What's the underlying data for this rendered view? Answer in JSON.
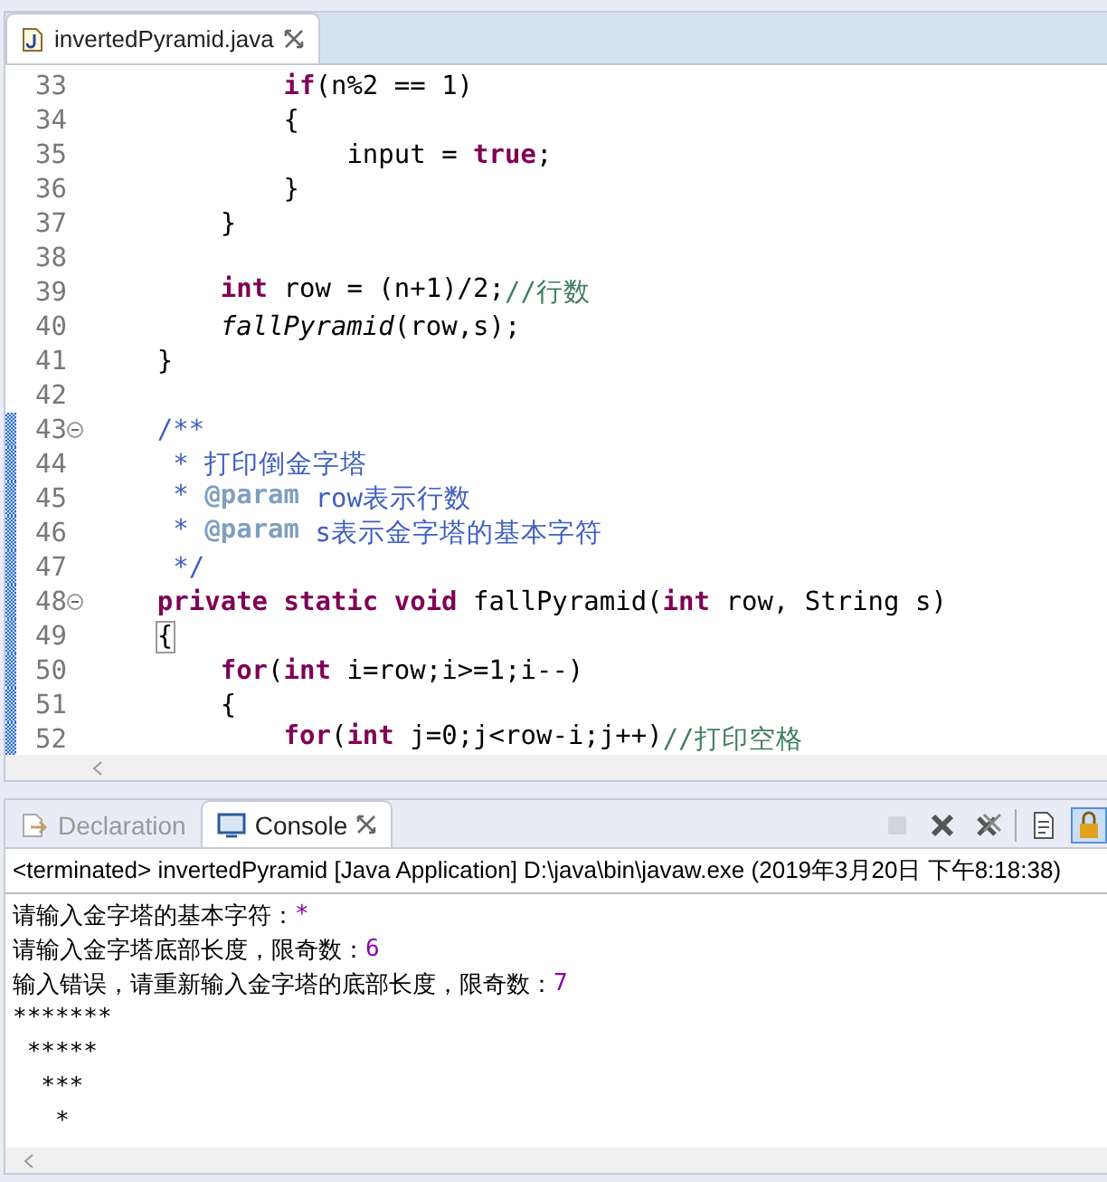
{
  "editor": {
    "tab": {
      "title": "invertedPyramid.java",
      "selected": true
    },
    "lines": [
      {
        "number": "33",
        "marked": false,
        "fold": false,
        "tokens": [
          {
            "kind": "kw",
            "text": "            if"
          },
          {
            "kind": "plain",
            "text": "(n%2 == 1)"
          }
        ]
      },
      {
        "number": "34",
        "marked": false,
        "fold": false,
        "tokens": [
          {
            "kind": "plain",
            "text": "            {"
          }
        ]
      },
      {
        "number": "35",
        "marked": false,
        "fold": false,
        "tokens": [
          {
            "kind": "plain",
            "text": "                input = "
          },
          {
            "kind": "kw",
            "text": "true"
          },
          {
            "kind": "plain",
            "text": ";"
          }
        ]
      },
      {
        "number": "36",
        "marked": false,
        "fold": false,
        "tokens": [
          {
            "kind": "plain",
            "text": "            }"
          }
        ]
      },
      {
        "number": "37",
        "marked": false,
        "fold": false,
        "tokens": [
          {
            "kind": "plain",
            "text": "        }"
          }
        ]
      },
      {
        "number": "38",
        "marked": false,
        "fold": false
      },
      {
        "number": "39",
        "marked": false,
        "fold": false,
        "tokens": [
          {
            "kind": "kw",
            "text": "        int"
          },
          {
            "kind": "plain",
            "text": " row = (n+1)/2;"
          },
          {
            "kind": "comment",
            "text": "//行数"
          }
        ]
      },
      {
        "number": "40",
        "marked": false,
        "fold": false,
        "tokens": [
          {
            "kind": "italic",
            "text": "        fallPyramid"
          },
          {
            "kind": "plain",
            "text": "(row,s);"
          }
        ]
      },
      {
        "number": "41",
        "marked": false,
        "fold": false,
        "tokens": [
          {
            "kind": "plain",
            "text": "    }"
          }
        ]
      },
      {
        "number": "42",
        "marked": false,
        "fold": false
      },
      {
        "number": "43",
        "marked": true,
        "fold": true,
        "tokens": [
          {
            "kind": "doc",
            "text": "    /**"
          }
        ]
      },
      {
        "number": "44",
        "marked": true,
        "fold": false,
        "tokens": [
          {
            "kind": "doc",
            "text": "     * 打印倒金字塔"
          }
        ]
      },
      {
        "number": "45",
        "marked": true,
        "fold": false,
        "tokens": [
          {
            "kind": "doc",
            "text": "     * "
          },
          {
            "kind": "doctag",
            "text": "@param"
          },
          {
            "kind": "doc",
            "text": " row表示行数"
          }
        ]
      },
      {
        "number": "46",
        "marked": true,
        "fold": false,
        "tokens": [
          {
            "kind": "doc",
            "text": "     * "
          },
          {
            "kind": "doctag",
            "text": "@param"
          },
          {
            "kind": "doc",
            "text": " s表示金字塔的基本字符"
          }
        ]
      },
      {
        "number": "47",
        "marked": true,
        "fold": false,
        "tokens": [
          {
            "kind": "doc",
            "text": "     */"
          }
        ]
      },
      {
        "number": "48",
        "marked": true,
        "fold": true,
        "tokens": [
          {
            "kind": "kw",
            "text": "    private static void"
          },
          {
            "kind": "plain",
            "text": " fallPyramid("
          },
          {
            "kind": "kw",
            "text": "int"
          },
          {
            "kind": "plain",
            "text": " row, String s)"
          }
        ]
      },
      {
        "number": "49",
        "marked": true,
        "fold": false,
        "tokens": [
          {
            "kind": "match",
            "text": "    {"
          }
        ]
      },
      {
        "number": "50",
        "marked": true,
        "fold": false,
        "tokens": [
          {
            "kind": "kw",
            "text": "        for"
          },
          {
            "kind": "plain",
            "text": "("
          },
          {
            "kind": "kw",
            "text": "int"
          },
          {
            "kind": "plain",
            "text": " i=row;i>=1;i--)"
          }
        ]
      },
      {
        "number": "51",
        "marked": true,
        "fold": false,
        "tokens": [
          {
            "kind": "plain",
            "text": "        {"
          }
        ]
      },
      {
        "number": "52",
        "marked": true,
        "fold": false,
        "tokens": [
          {
            "kind": "kw",
            "text": "            for"
          },
          {
            "kind": "plain",
            "text": "("
          },
          {
            "kind": "kw",
            "text": "int"
          },
          {
            "kind": "plain",
            "text": " j=0;j<row-i;j++)"
          },
          {
            "kind": "comment",
            "text": "//打印空格"
          }
        ]
      }
    ]
  },
  "console": {
    "tabs": [
      {
        "kind": "declaration",
        "label": "Declaration",
        "selected": false
      },
      {
        "kind": "console",
        "label": "Console",
        "selected": true
      }
    ],
    "toolbar": [
      {
        "kind": "terminate",
        "disabled": true,
        "selected": false
      },
      {
        "kind": "remove",
        "disabled": false,
        "selected": false
      },
      {
        "kind": "remove-all",
        "disabled": false,
        "selected": false
      },
      {
        "kind": "separator"
      },
      {
        "kind": "document",
        "disabled": false,
        "selected": false
      },
      {
        "kind": "lock",
        "disabled": false,
        "selected": true
      }
    ],
    "header": "<terminated> invertedPyramid [Java Application] D:\\java\\bin\\javaw.exe (2019年3月20日 下午8:18:38)",
    "lines": [
      {
        "segments": [
          {
            "kind": "out",
            "text": "请输入金字塔的基本字符："
          },
          {
            "kind": "in",
            "text": "*"
          }
        ]
      },
      {
        "segments": [
          {
            "kind": "out",
            "text": "请输入金字塔底部长度，限奇数："
          },
          {
            "kind": "in",
            "text": "6"
          }
        ]
      },
      {
        "segments": [
          {
            "kind": "out",
            "text": "输入错误，请重新输入金字塔的底部长度，限奇数："
          },
          {
            "kind": "in",
            "text": "7"
          }
        ]
      },
      {
        "segments": [
          {
            "kind": "out",
            "text": "*******"
          }
        ]
      },
      {
        "segments": [
          {
            "kind": "out",
            "text": " *****"
          }
        ]
      },
      {
        "segments": [
          {
            "kind": "out",
            "text": "  ***"
          }
        ]
      },
      {
        "segments": [
          {
            "kind": "out",
            "text": "   *"
          }
        ]
      }
    ]
  }
}
